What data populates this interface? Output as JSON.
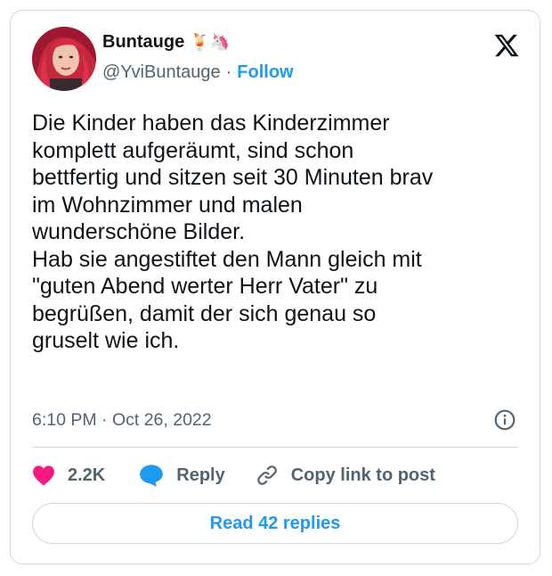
{
  "author": {
    "display_name": "Buntauge",
    "emoji": "🍹🦄",
    "handle": "@YviBuntauge",
    "separator": "·",
    "follow_label": "Follow"
  },
  "tweet": {
    "text": "Die Kinder haben das Kinderzimmer\nkomplett aufgeräumt, sind schon\nbettfertig und sitzen seit 30 Minuten brav\nim Wohnzimmer und malen\nwunderschöne Bilder.\nHab sie angestiftet den Mann gleich mit\n\"guten Abend werter Herr Vater\" zu\nbegrüßen, damit der sich genau so\ngruselt wie ich.",
    "timestamp": "6:10 PM · Oct 26, 2022"
  },
  "actions": {
    "like_count": "2.2K",
    "reply_label": "Reply",
    "copy_label": "Copy link to post"
  },
  "footer": {
    "read_replies_label": "Read 42 replies"
  },
  "icons": {
    "logo": "x-logo-icon",
    "info": "info-icon",
    "like": "heart-icon",
    "reply": "speech-bubble-icon",
    "copy": "link-icon"
  },
  "colors": {
    "accent": "#1d9bf0",
    "like": "#f91880",
    "secondary_text": "#536471",
    "border": "#cfd9de"
  }
}
